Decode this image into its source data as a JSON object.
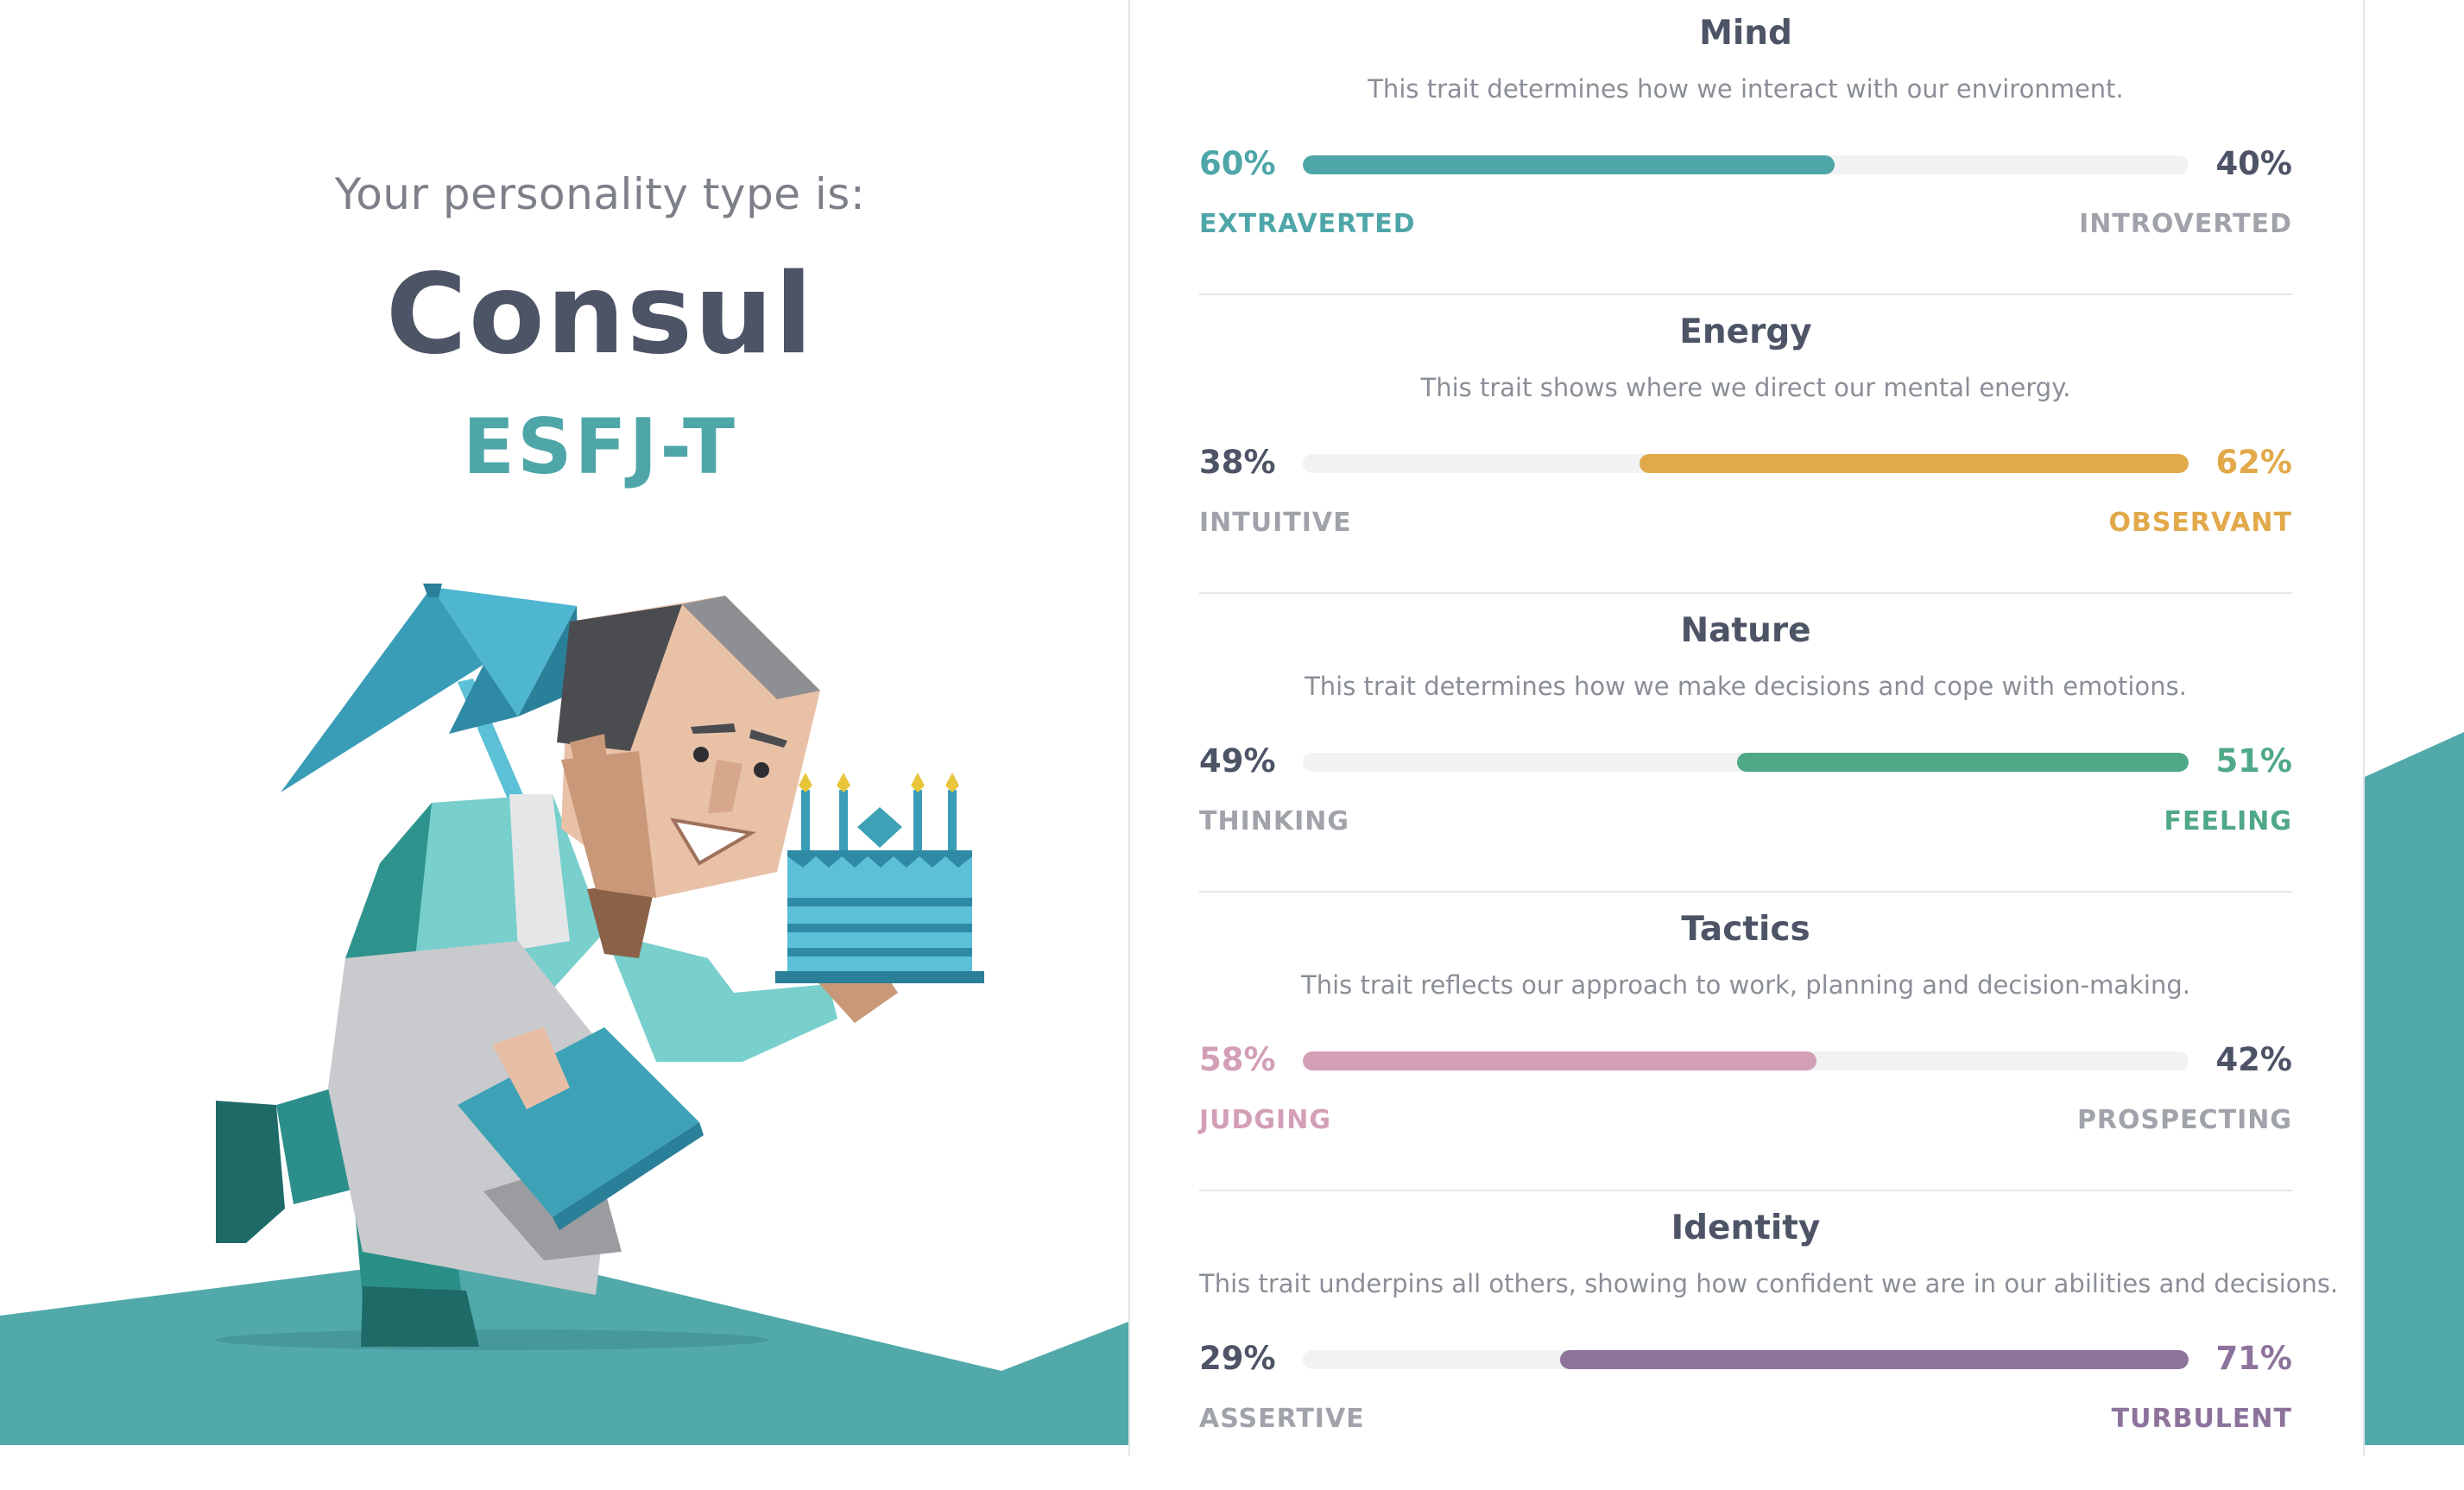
{
  "result": {
    "intro": "Your personality type is:",
    "type_name": "Consul",
    "type_code": "ESFJ-T",
    "illustration_icon": "consul-character-with-cake-illustration"
  },
  "colors": {
    "teal": "#4fa6a8",
    "gold": "#e2a94a",
    "green": "#4fa886",
    "pink": "#d39fb6",
    "purple": "#8d739b",
    "heading": "#4d5466"
  },
  "traits": [
    {
      "title": "Mind",
      "description": "This trait determines how we interact with our environment.",
      "left_percent": "60%",
      "left_label": "EXTRAVERTED",
      "right_percent": "40%",
      "right_label": "INTROVERTED",
      "dominant": "left",
      "dominant_fraction": 0.6,
      "color": "#4fa6a8"
    },
    {
      "title": "Energy",
      "description": "This trait shows where we direct our mental energy.",
      "left_percent": "38%",
      "left_label": "INTUITIVE",
      "right_percent": "62%",
      "right_label": "OBSERVANT",
      "dominant": "right",
      "dominant_fraction": 0.62,
      "color": "#e2a94a"
    },
    {
      "title": "Nature",
      "description": "This trait determines how we make decisions and cope with emotions.",
      "left_percent": "49%",
      "left_label": "THINKING",
      "right_percent": "51%",
      "right_label": "FEELING",
      "dominant": "right",
      "dominant_fraction": 0.51,
      "color": "#4fa886"
    },
    {
      "title": "Tactics",
      "description": "This trait reflects our approach to work, planning and decision-making.",
      "left_percent": "58%",
      "left_label": "JUDGING",
      "right_percent": "42%",
      "right_label": "PROSPECTING",
      "dominant": "left",
      "dominant_fraction": 0.58,
      "color": "#d39fb6"
    },
    {
      "title": "Identity",
      "description": "This trait underpins all others, showing how confident we are in our abilities and decisions.",
      "left_percent": "29%",
      "left_label": "ASSERTIVE",
      "right_percent": "71%",
      "right_label": "TURBULENT",
      "dominant": "right",
      "dominant_fraction": 0.71,
      "color": "#8d739b"
    }
  ]
}
